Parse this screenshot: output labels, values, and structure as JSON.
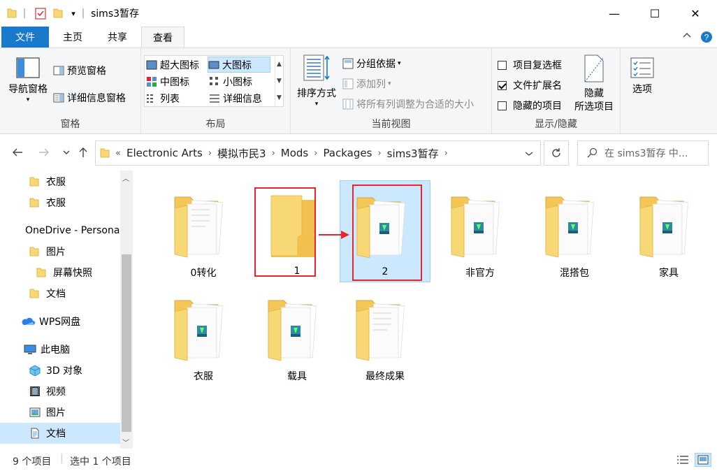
{
  "window": {
    "title": "sims3暂存",
    "controls": {
      "minimize": "—",
      "maximize": "☐",
      "close": "✕"
    }
  },
  "ribbon_tabs": [
    {
      "label": "文件"
    },
    {
      "label": "主页"
    },
    {
      "label": "共享"
    },
    {
      "label": "查看"
    }
  ],
  "ribbon": {
    "panes": {
      "label": "窗格",
      "nav_pane": "导航窗格",
      "preview_pane": "预览窗格",
      "details_pane": "详细信息窗格"
    },
    "layout": {
      "label": "布局",
      "options": [
        "超大图标",
        "大图标",
        "中图标",
        "小图标",
        "列表",
        "详细信息"
      ],
      "selected": "大图标"
    },
    "current_view": {
      "label": "当前视图",
      "sort_by": "排序方式",
      "group_by": "分组依据",
      "add_columns": "添加列",
      "size_all_columns": "将所有列调整为合适的大小"
    },
    "show_hide": {
      "label": "显示/隐藏",
      "item_checkboxes": "项目复选框",
      "item_checkboxes_checked": false,
      "file_extensions": "文件扩展名",
      "file_extensions_checked": true,
      "hidden_items": "隐藏的项目",
      "hidden_items_checked": false,
      "hide_selected_line1": "隐藏",
      "hide_selected_line2": "所选项目"
    },
    "options": {
      "label": "选项"
    }
  },
  "address_bar": {
    "breadcrumb": [
      "Electronic Arts",
      "模拟市民3",
      "Mods",
      "Packages",
      "sims3暂存"
    ],
    "overflow": "«",
    "search_placeholder": "在 sims3暂存 中..."
  },
  "nav_pane": {
    "items": [
      {
        "label": "衣服",
        "icon": "folder-icon"
      },
      {
        "label": "衣服",
        "icon": "folder-icon"
      },
      {
        "label": "OneDrive - Personal",
        "icon": "onedrive-icon"
      },
      {
        "label": "图片",
        "icon": "folder-icon"
      },
      {
        "label": "屏幕快照",
        "icon": "folder-icon"
      },
      {
        "label": "文档",
        "icon": "folder-icon"
      },
      {
        "label": "WPS网盘",
        "icon": "wps-cloud-icon"
      },
      {
        "label": "此电脑",
        "icon": "computer-icon"
      },
      {
        "label": "3D 对象",
        "icon": "3d-objects-icon"
      },
      {
        "label": "视频",
        "icon": "video-icon"
      },
      {
        "label": "图片",
        "icon": "pictures-icon"
      },
      {
        "label": "文档",
        "icon": "documents-icon"
      }
    ],
    "selected_index": 11
  },
  "folders": [
    {
      "name": "0转化",
      "type": "docs"
    },
    {
      "name": "1",
      "type": "empty"
    },
    {
      "name": "2",
      "type": "sims"
    },
    {
      "name": "非官方",
      "type": "sims"
    },
    {
      "name": "混搭包",
      "type": "sims"
    },
    {
      "name": "家具",
      "type": "sims"
    },
    {
      "name": "衣服",
      "type": "sims"
    },
    {
      "name": "载具",
      "type": "sims"
    },
    {
      "name": "最终成果",
      "type": "docs"
    }
  ],
  "selected_folder": "2",
  "status": {
    "item_count": "9 个项目",
    "selection": "选中 1 个项目"
  },
  "colors": {
    "accent": "#1979ca",
    "selection": "#cce8ff",
    "annotation_red": "#e8252b",
    "folder": "#f8d775"
  }
}
